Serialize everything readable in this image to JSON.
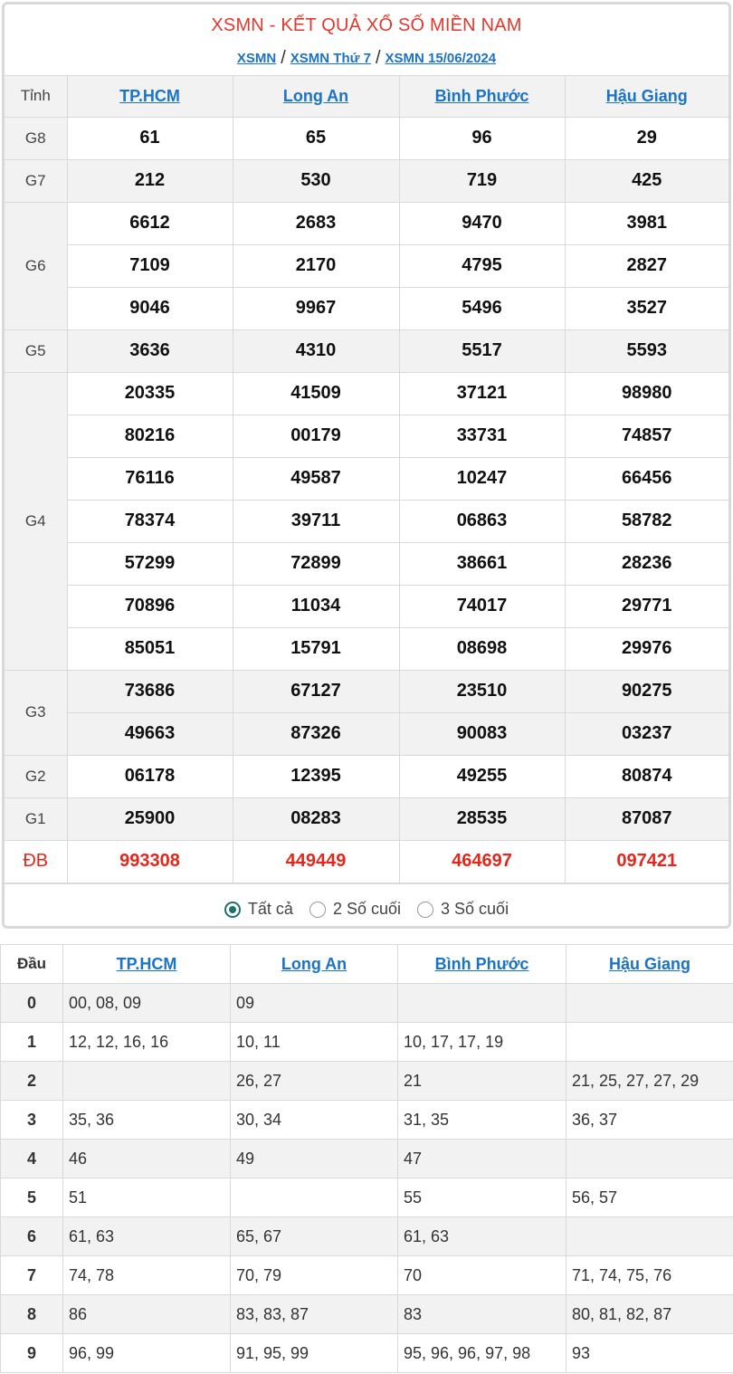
{
  "header": {
    "title": "XSMN - KẾT QUẢ XỔ SỐ MIỀN NAM",
    "breadcrumbs": [
      "XSMN",
      "XSMN Thứ 7",
      "XSMN 15/06/2024"
    ],
    "separator": "/"
  },
  "results": {
    "col_label": "Tỉnh",
    "provinces": [
      "TP.HCM",
      "Long An",
      "Bình Phước",
      "Hậu Giang"
    ],
    "prizes": [
      {
        "label": "G8",
        "rows": [
          [
            "61",
            "65",
            "96",
            "29"
          ]
        ]
      },
      {
        "label": "G7",
        "rows": [
          [
            "212",
            "530",
            "719",
            "425"
          ]
        ]
      },
      {
        "label": "G6",
        "rows": [
          [
            "6612",
            "2683",
            "9470",
            "3981"
          ],
          [
            "7109",
            "2170",
            "4795",
            "2827"
          ],
          [
            "9046",
            "9967",
            "5496",
            "3527"
          ]
        ]
      },
      {
        "label": "G5",
        "rows": [
          [
            "3636",
            "4310",
            "5517",
            "5593"
          ]
        ]
      },
      {
        "label": "G4",
        "rows": [
          [
            "20335",
            "41509",
            "37121",
            "98980"
          ],
          [
            "80216",
            "00179",
            "33731",
            "74857"
          ],
          [
            "76116",
            "49587",
            "10247",
            "66456"
          ],
          [
            "78374",
            "39711",
            "06863",
            "58782"
          ],
          [
            "57299",
            "72899",
            "38661",
            "28236"
          ],
          [
            "70896",
            "11034",
            "74017",
            "29771"
          ],
          [
            "85051",
            "15791",
            "08698",
            "29976"
          ]
        ]
      },
      {
        "label": "G3",
        "rows": [
          [
            "73686",
            "67127",
            "23510",
            "90275"
          ],
          [
            "49663",
            "87326",
            "90083",
            "03237"
          ]
        ]
      },
      {
        "label": "G2",
        "rows": [
          [
            "06178",
            "12395",
            "49255",
            "80874"
          ]
        ]
      },
      {
        "label": "G1",
        "rows": [
          [
            "25900",
            "08283",
            "28535",
            "87087"
          ]
        ]
      },
      {
        "label": "ĐB",
        "rows": [
          [
            "993308",
            "449449",
            "464697",
            "097421"
          ]
        ]
      }
    ]
  },
  "filter": {
    "options": [
      "Tất cả",
      "2 Số cuối",
      "3 Số cuối"
    ],
    "selected": 0
  },
  "loto": {
    "col_label": "Đầu",
    "provinces": [
      "TP.HCM",
      "Long An",
      "Bình Phước",
      "Hậu Giang"
    ],
    "rows": [
      [
        "0",
        "00, 08, 09",
        "09",
        "",
        ""
      ],
      [
        "1",
        "12, 12, 16, 16",
        "10, 11",
        "10, 17, 17, 19",
        ""
      ],
      [
        "2",
        "",
        "26, 27",
        "21",
        "21, 25, 27, 27, 29"
      ],
      [
        "3",
        "35, 36",
        "30, 34",
        "31, 35",
        "36, 37"
      ],
      [
        "4",
        "46",
        "49",
        "47",
        ""
      ],
      [
        "5",
        "51",
        "",
        "55",
        "56, 57"
      ],
      [
        "6",
        "61, 63",
        "65, 67",
        "61, 63",
        ""
      ],
      [
        "7",
        "74, 78",
        "70, 79",
        "70",
        "71, 74, 75, 76"
      ],
      [
        "8",
        "86",
        "83, 83, 87",
        "83",
        "80, 81, 82, 87"
      ],
      [
        "9",
        "96, 99",
        "91, 95, 99",
        "95, 96, 96, 97, 98",
        "93"
      ]
    ]
  },
  "colors": {
    "accent": "#1a73c6",
    "special": "#e4271c",
    "title": "#e0392b",
    "shade": "#f2f2f2"
  }
}
